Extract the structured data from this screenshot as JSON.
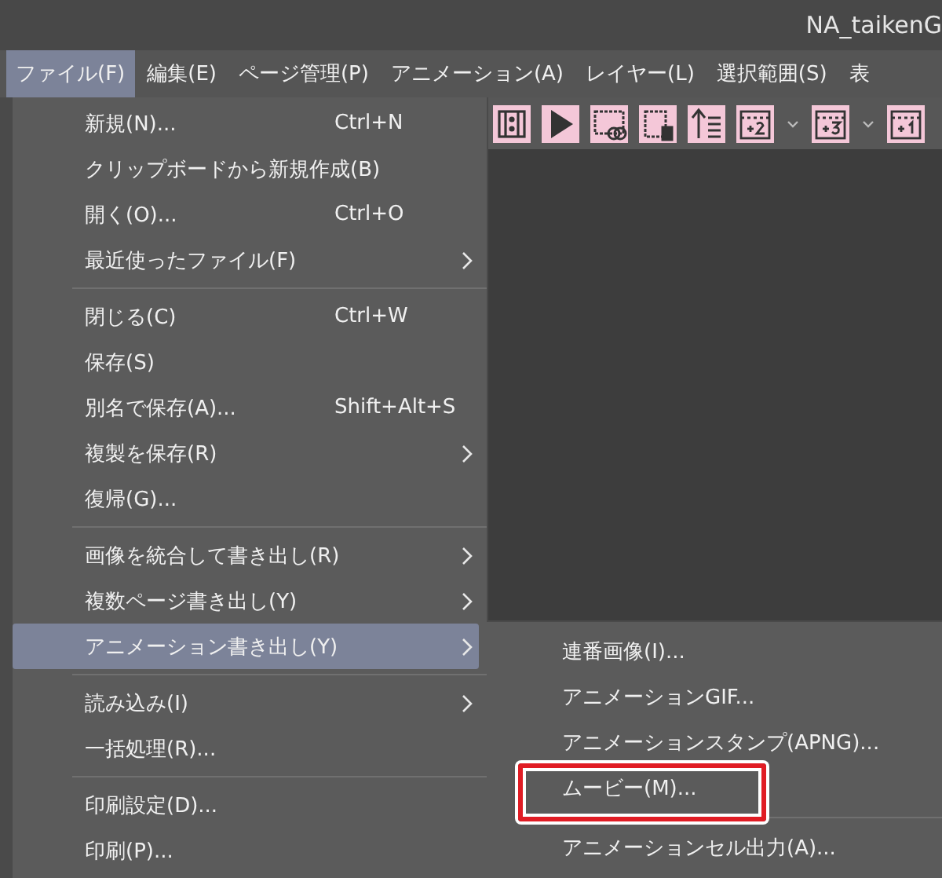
{
  "window": {
    "title": "NA_taikenG"
  },
  "menubar": [
    {
      "label": "ファイル(F)",
      "selected": true
    },
    {
      "label": "編集(E)",
      "selected": false
    },
    {
      "label": "ページ管理(P)",
      "selected": false
    },
    {
      "label": "アニメーション(A)",
      "selected": false
    },
    {
      "label": "レイヤー(L)",
      "selected": false
    },
    {
      "label": "選択範囲(S)",
      "selected": false
    },
    {
      "label": "表",
      "selected": false
    }
  ],
  "toolbar": [
    {
      "kind": "frames"
    },
    {
      "kind": "play"
    },
    {
      "kind": "loop"
    },
    {
      "kind": "delete"
    },
    {
      "kind": "order"
    },
    {
      "kind": "plus2",
      "dropdown": true
    },
    {
      "kind": "plus3",
      "dropdown": true
    },
    {
      "kind": "plus1"
    }
  ],
  "file_menu": [
    {
      "kind": "item",
      "label": "新規(N)...",
      "shortcut": "Ctrl+N",
      "submenu": false,
      "selected": false
    },
    {
      "kind": "item",
      "label": "クリップボードから新規作成(B)",
      "submenu": false,
      "selected": false
    },
    {
      "kind": "item",
      "label": "開く(O)...",
      "shortcut": "Ctrl+O",
      "submenu": false,
      "selected": false
    },
    {
      "kind": "item",
      "label": "最近使ったファイル(F)",
      "submenu": true,
      "selected": false
    },
    {
      "kind": "separator"
    },
    {
      "kind": "item",
      "label": "閉じる(C)",
      "shortcut": "Ctrl+W",
      "submenu": false,
      "selected": false
    },
    {
      "kind": "item",
      "label": "保存(S)",
      "submenu": false,
      "selected": false
    },
    {
      "kind": "item",
      "label": "別名で保存(A)...",
      "shortcut": "Shift+Alt+S",
      "submenu": false,
      "selected": false
    },
    {
      "kind": "item",
      "label": "複製を保存(R)",
      "submenu": true,
      "selected": false
    },
    {
      "kind": "item",
      "label": "復帰(G)...",
      "submenu": false,
      "selected": false
    },
    {
      "kind": "separator"
    },
    {
      "kind": "item",
      "label": "画像を統合して書き出し(R)",
      "submenu": true,
      "selected": false
    },
    {
      "kind": "item",
      "label": "複数ページ書き出し(Y)",
      "submenu": true,
      "selected": false
    },
    {
      "kind": "item",
      "label": "アニメーション書き出し(Y)",
      "submenu": true,
      "selected": true
    },
    {
      "kind": "separator"
    },
    {
      "kind": "item",
      "label": "読み込み(I)",
      "submenu": true,
      "selected": false
    },
    {
      "kind": "item",
      "label": "一括処理(R)...",
      "submenu": false,
      "selected": false
    },
    {
      "kind": "separator"
    },
    {
      "kind": "item",
      "label": "印刷設定(D)...",
      "submenu": false,
      "selected": false
    },
    {
      "kind": "item",
      "label": "印刷(P)...",
      "submenu": false,
      "selected": false
    }
  ],
  "submenu": [
    {
      "kind": "item",
      "label": "連番画像(I)...",
      "highlighted": false
    },
    {
      "kind": "item",
      "label": "アニメーションGIF...",
      "highlighted": false
    },
    {
      "kind": "item",
      "label": "アニメーションスタンプ(APNG)...",
      "highlighted": false
    },
    {
      "kind": "item",
      "label": "ムービー(M)...",
      "highlighted": true
    },
    {
      "kind": "separator"
    },
    {
      "kind": "item",
      "label": "アニメーションセル出力(A)...",
      "highlighted": false
    }
  ]
}
